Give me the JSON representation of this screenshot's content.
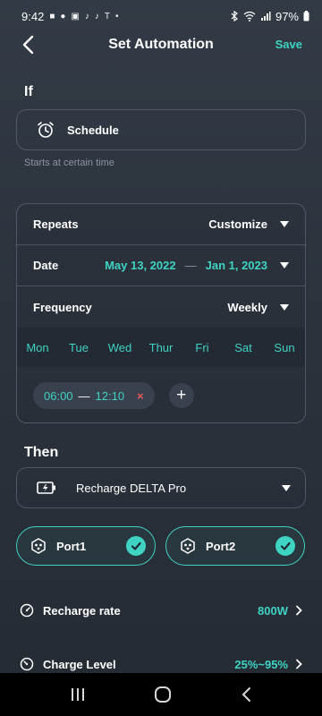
{
  "status": {
    "time": "9:42",
    "battery": "97%"
  },
  "header": {
    "title": "Set Automation",
    "save_label": "Save"
  },
  "if_section": {
    "title": "If",
    "trigger_label": "Schedule",
    "hint": "Starts at certain time"
  },
  "rules": {
    "repeats_label": "Repeats",
    "repeats_value": "Customize",
    "date_label": "Date",
    "date_start": "May 13, 2022",
    "date_sep": "—",
    "date_end": "Jan 1, 2023",
    "frequency_label": "Frequency",
    "frequency_value": "Weekly",
    "days": [
      "Mon",
      "Tue",
      "Wed",
      "Thur",
      "Fri",
      "Sat",
      "Sun"
    ],
    "time_start": "06:00",
    "time_sep": "—",
    "time_end": "12:10",
    "remove_symbol": "×",
    "add_symbol": "+"
  },
  "then_section": {
    "title": "Then",
    "device_label": "Recharge DELTA Pro"
  },
  "ports": [
    {
      "label": "Port1",
      "selected": true
    },
    {
      "label": "Port2",
      "selected": true
    }
  ],
  "settings": {
    "recharge_rate_label": "Recharge rate",
    "recharge_rate_value": "800W",
    "charge_level_label": "Charge Level",
    "charge_level_value": "25%~95%"
  },
  "colors": {
    "accent": "#3fd3c4",
    "danger": "#e55a5a",
    "background": "#2c333d"
  }
}
